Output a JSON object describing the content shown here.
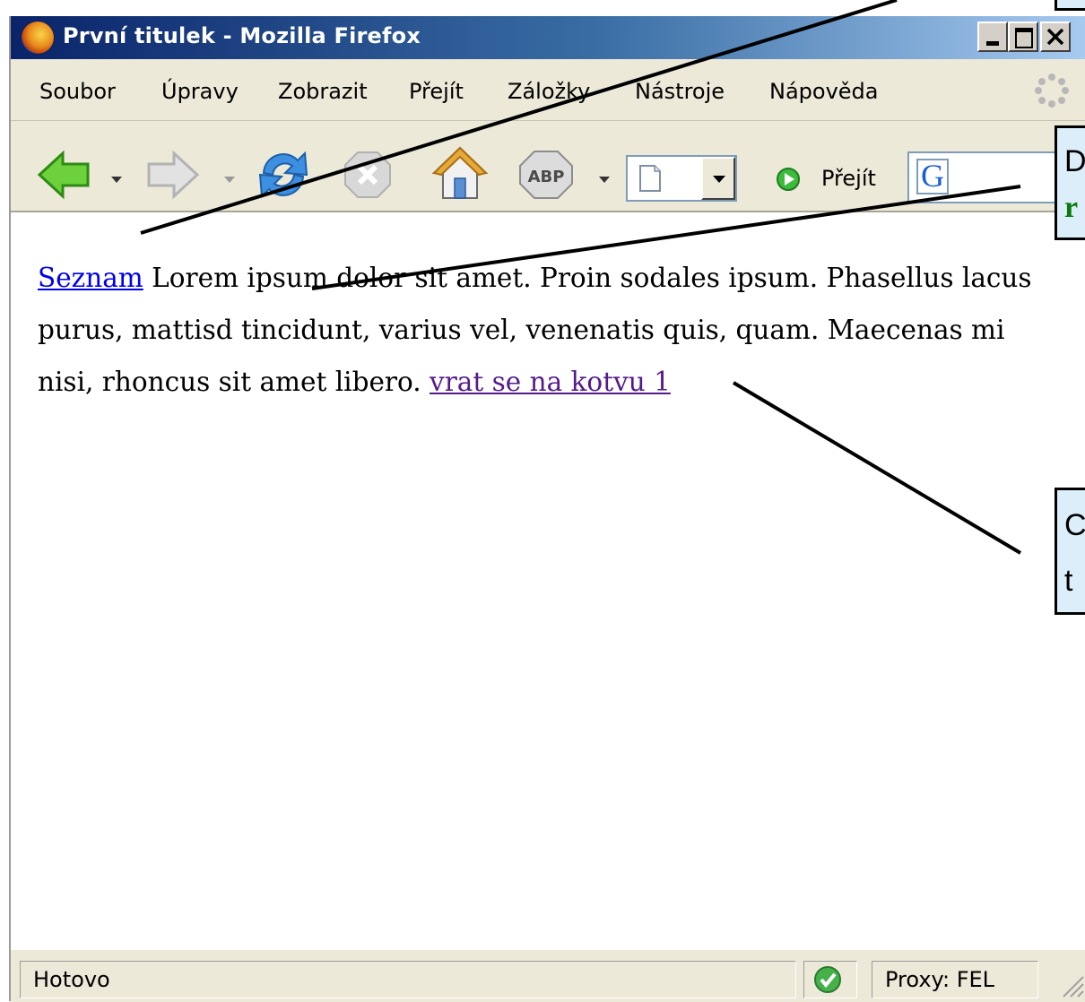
{
  "window": {
    "title": "První titulek - Mozilla Firefox"
  },
  "menubar": {
    "items": [
      {
        "label": "Soubor"
      },
      {
        "label": "Úpravy"
      },
      {
        "label": "Zobrazit"
      },
      {
        "label": "Přejít"
      },
      {
        "label": "Záložky"
      },
      {
        "label": "Nástroje"
      },
      {
        "label": "Nápověda"
      }
    ]
  },
  "toolbar": {
    "adblock_label": "ABP",
    "go_label": "Přejít",
    "search_engine_icon": "google-g-icon"
  },
  "content": {
    "link1": "Seznam",
    "text": " Lorem ipsum dolor sit amet. Proin sodales ipsum. Phasellus lacus purus, mattisd tincidunt, varius vel, venenatis quis, quam. Maecenas mi nisi, rhoncus sit amet libero. ",
    "link2": "vrat se na kotvu 1"
  },
  "statusbar": {
    "status": "Hotovo",
    "proxy": "Proxy: FEL"
  },
  "callouts": {
    "right_middle_line1": "D",
    "right_middle_line2": "r",
    "right_lower_line1": "C",
    "right_lower_line2": "t"
  },
  "colors": {
    "link": "#0000ee",
    "visited_link": "#551a8b",
    "callout_bg": "#dbeefa"
  }
}
